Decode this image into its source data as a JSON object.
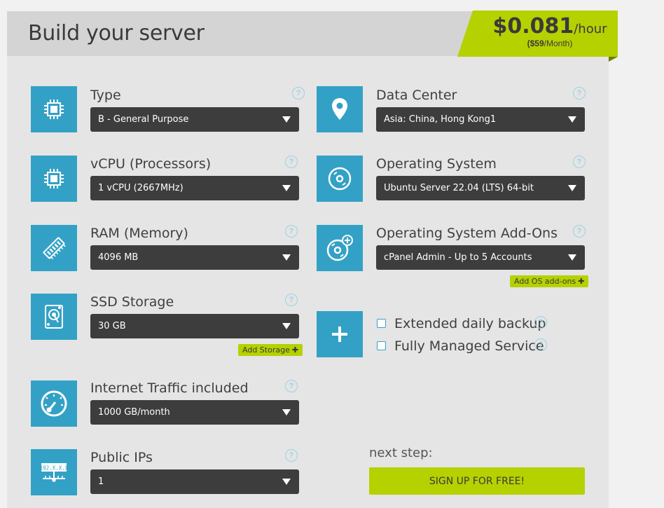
{
  "header": {
    "title": "Build your server",
    "price_amount": "$0.081",
    "price_unit": "/hour",
    "price_month_amount": "($59",
    "price_month_unit": "/Month)"
  },
  "help_glyph": "?",
  "fields": {
    "type": {
      "label": "Type",
      "value": "B - General Purpose",
      "icon": "chip-icon"
    },
    "vcpu": {
      "label": "vCPU (Processors)",
      "value": "1 vCPU (2667MHz)",
      "icon": "processor-icon"
    },
    "ram": {
      "label": "RAM (Memory)",
      "value": "4096 MB",
      "icon": "memory-icon"
    },
    "ssd": {
      "label": "SSD Storage",
      "value": "30 GB",
      "icon": "hard-drive-icon",
      "add_label": "Add Storage"
    },
    "traffic": {
      "label": "Internet Traffic included",
      "value": "1000 GB/month",
      "icon": "speedometer-icon"
    },
    "ips": {
      "label": "Public IPs",
      "value": "1",
      "icon": "ip-network-icon",
      "icon_text": "192.X.X.X"
    },
    "datacenter": {
      "label": "Data Center",
      "value": "Asia: China, Hong Kong1",
      "icon": "map-pin-icon"
    },
    "os": {
      "label": "Operating System",
      "value": "Ubuntu Server 22.04 (LTS) 64-bit",
      "icon": "disc-icon"
    },
    "os_addons": {
      "label": "Operating System Add-Ons",
      "value": "cPanel Admin - Up to 5 Accounts",
      "icon": "disc-plus-icon",
      "add_label": "Add OS add-ons"
    }
  },
  "extras": {
    "icon": "plus-icon",
    "backup": {
      "label": "Extended daily backup",
      "checked": false
    },
    "managed": {
      "label": "Fully Managed Service",
      "checked": false
    }
  },
  "footer": {
    "next_label": "next step:",
    "signup_label": "SIGN UP FOR FREE!"
  },
  "colors": {
    "accent": "#33a1c6",
    "lime": "#b6d100",
    "select_bg": "#3d3d3d"
  }
}
